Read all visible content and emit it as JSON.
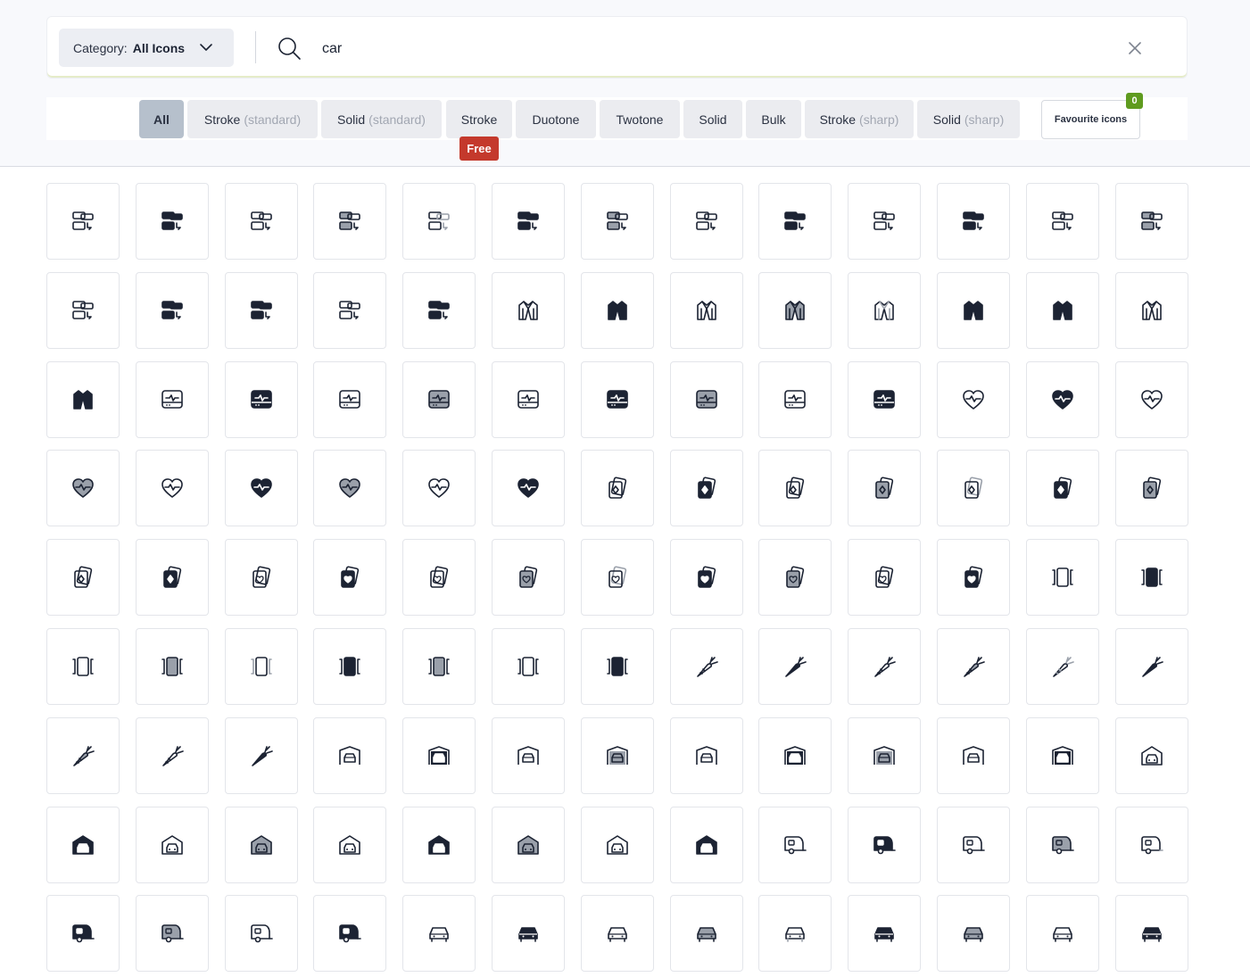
{
  "search": {
    "category_label": "Category:",
    "category_value": "All Icons",
    "query": "car",
    "clear_icon": "close-icon"
  },
  "filters": {
    "chips": [
      {
        "label": "All",
        "sub": "",
        "active": true
      },
      {
        "label": "Stroke",
        "sub": "(standard)",
        "active": false
      },
      {
        "label": "Solid",
        "sub": "(standard)",
        "active": false
      },
      {
        "label": "Stroke",
        "sub": "",
        "active": false
      },
      {
        "label": "Duotone",
        "sub": "",
        "active": false
      },
      {
        "label": "Twotone",
        "sub": "",
        "active": false
      },
      {
        "label": "Solid",
        "sub": "",
        "active": false
      },
      {
        "label": "Bulk",
        "sub": "",
        "active": false
      },
      {
        "label": "Stroke",
        "sub": "(sharp)",
        "active": false
      },
      {
        "label": "Solid",
        "sub": "(sharp)",
        "active": false
      }
    ],
    "free_badge": "Free",
    "favourite_label": "Favourite icons",
    "favourite_count": "0"
  },
  "icons": [
    "cardboard-layers-stroke",
    "cardboard-layers-solid",
    "cardboard-layers-stroke",
    "cardboard-layers-duotone",
    "cardboard-layers-twotone",
    "cardboard-layers-solid",
    "cardboard-layers-bulk",
    "cardboard-layers-stroke",
    "cardboard-layers-solid",
    "cardboard-layers-stroke",
    "cardboard-layers-solid",
    "cardboard-layers-stroke",
    "cardboard-layers-duotone",
    "cardboard-layers-stroke",
    "cardboard-layers-solid",
    "cardboard-layers-solid",
    "cardboard-layers-stroke",
    "cardboard-layers-solid",
    "cardigan-stroke",
    "cardigan-solid",
    "cardigan-stroke",
    "cardigan-duotone",
    "cardigan-twotone",
    "cardigan-solid",
    "cardigan-solid",
    "cardigan-stroke",
    "cardigan-solid",
    "cardiogram-stroke",
    "cardiogram-solid",
    "cardiogram-stroke",
    "cardiogram-duotone",
    "cardiogram-twotone",
    "cardiogram-solid",
    "cardiogram-bulk",
    "cardiogram-stroke",
    "cardiogram-solid",
    "heart-pulse-stroke",
    "heart-pulse-solid",
    "heart-pulse-stroke",
    "heart-pulse-duotone",
    "heart-pulse-twotone",
    "heart-pulse-solid",
    "heart-pulse-bulk",
    "heart-pulse-stroke",
    "heart-pulse-solid",
    "cards-diamond-stroke",
    "cards-diamond-solid",
    "cards-diamond-stroke",
    "cards-diamond-duotone",
    "cards-diamond-twotone",
    "cards-diamond-solid",
    "cards-diamond-bulk",
    "cards-diamond-stroke",
    "cards-diamond-solid",
    "cards-heart-stroke",
    "cards-heart-solid",
    "cards-heart-stroke",
    "cards-heart-duotone",
    "cards-heart-twotone",
    "cards-heart-solid",
    "cards-heart-bulk",
    "cards-heart-stroke",
    "cards-heart-solid",
    "carousel-stroke",
    "carousel-solid",
    "carousel-stroke",
    "carousel-duotone",
    "carousel-twotone",
    "carousel-solid",
    "carousel-bulk",
    "carousel-stroke",
    "carousel-solid",
    "carrot-stroke",
    "carrot-solid",
    "carrot-stroke",
    "carrot-duotone",
    "carrot-twotone",
    "carrot-solid",
    "carrot-bulk",
    "carrot-stroke",
    "carrot-solid",
    "car-garage-stroke",
    "car-garage-solid",
    "car-garage-stroke",
    "car-garage-duotone",
    "car-garage-twotone",
    "car-garage-solid",
    "car-garage-bulk",
    "car-garage-stroke",
    "car-garage-solid",
    "car-parking-stroke",
    "car-parking-solid",
    "car-parking-stroke",
    "car-parking-duotone",
    "car-parking-twotone",
    "car-parking-solid",
    "car-parking-bulk",
    "car-parking-stroke",
    "car-parking-solid",
    "caravan-stroke",
    "caravan-solid",
    "caravan-stroke",
    "caravan-duotone",
    "caravan-twotone",
    "caravan-solid",
    "caravan-bulk",
    "caravan-stroke",
    "caravan-solid",
    "car-stroke",
    "car-solid",
    "car-stroke",
    "car-duotone",
    "car-twotone",
    "car-solid",
    "car-bulk",
    "car-stroke",
    "car-solid"
  ]
}
